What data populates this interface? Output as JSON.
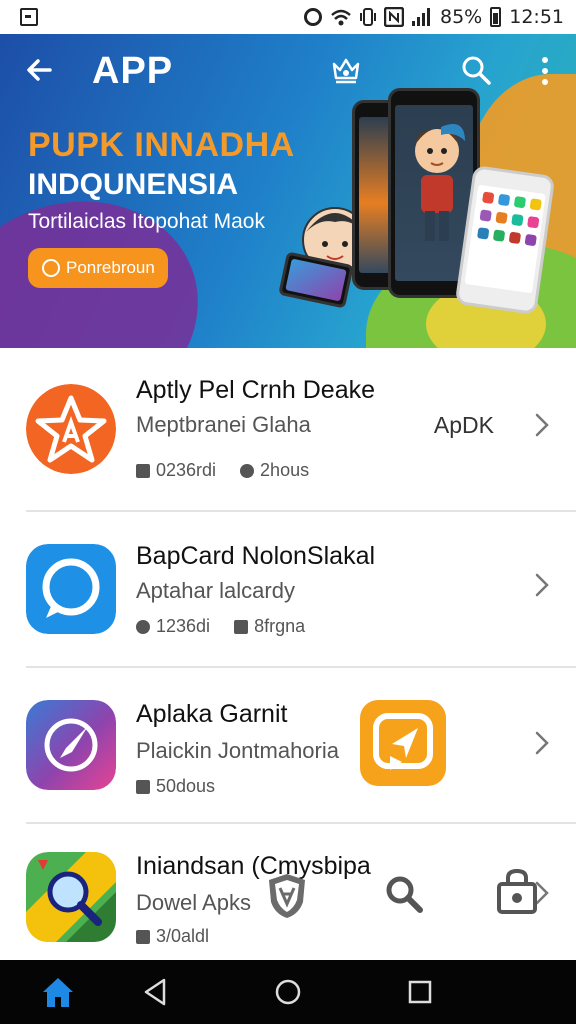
{
  "status_bar": {
    "battery_text": "85%",
    "time": "12:51",
    "icons": [
      "screenshot-icon",
      "alarm-icon",
      "wifi-icon",
      "vibrate-icon",
      "nfc-icon",
      "signal-icon",
      "battery-icon"
    ]
  },
  "app_bar": {
    "title": "APP",
    "icons": [
      "back-arrow-icon",
      "crown-icon",
      "search-icon",
      "more-vert-icon"
    ]
  },
  "banner": {
    "headline": "PUPK INNADHA",
    "subheadline": "INDQUNENSIA",
    "tagline": "Tortilaiclas Itopohat Maok",
    "button_label": "Ponrebroun",
    "colors": {
      "headline": "#f39a2b",
      "button": "#f7941d"
    }
  },
  "apps": [
    {
      "name": "Aptly Pel Crnh Deake",
      "subtitle": "Meptbranei Glaha",
      "tag": "ApDK",
      "meta1": "0236rdi",
      "meta2": "2hous",
      "icon": "star-a-icon"
    },
    {
      "name": "BapCard NolonSlakal",
      "subtitle": "Aptahar lalcardy",
      "tag": "",
      "meta1": "1236di",
      "meta2": "8frgna",
      "icon": "chat-bubble-icon"
    },
    {
      "name": "Aplaka Garnit",
      "subtitle": "Plaickin Jontmahoria",
      "tag": "",
      "meta1": "50dous",
      "meta2": "",
      "icon": "compass-icon"
    },
    {
      "name": "Iniandsan (Cmysbipa",
      "subtitle": "Dowel Apks",
      "tag": "",
      "meta1": "3/0aldl",
      "meta2": "",
      "icon": "magnifier-map-icon"
    }
  ],
  "floating_icons": [
    "orange-message-icon",
    "shield-badge-icon",
    "search-icon",
    "lock-bag-icon"
  ],
  "nav_bar": [
    "home-icon",
    "back-icon",
    "home-circle-icon",
    "recents-icon"
  ]
}
